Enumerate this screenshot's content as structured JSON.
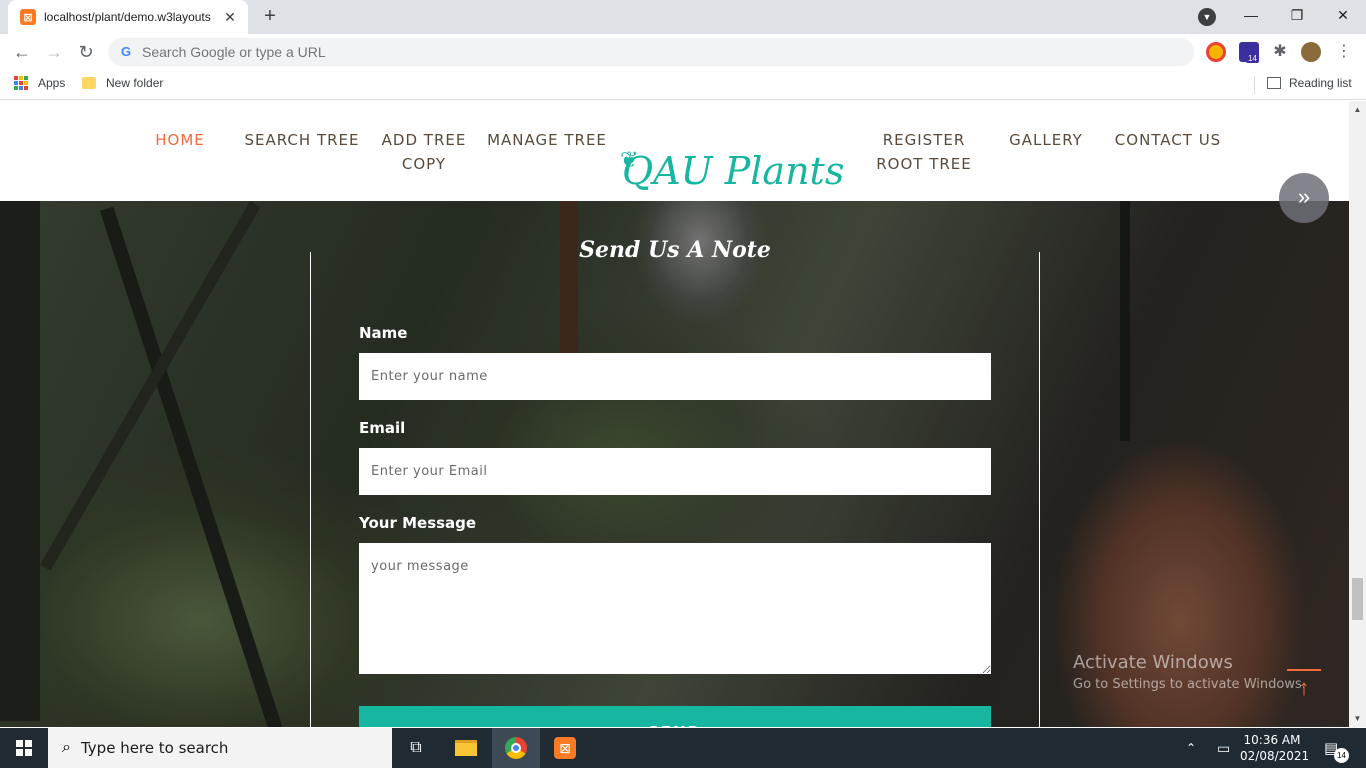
{
  "browser": {
    "tab_title": "localhost/plant/demo.w3layouts",
    "tab_close": "✕",
    "new_tab": "+",
    "omnibox_placeholder": "Search Google or type a URL",
    "profile_badge": "14",
    "bookmarks": {
      "apps": "Apps",
      "folder": "New folder",
      "reading_list": "Reading list"
    }
  },
  "site": {
    "nav": [
      {
        "label": "HOME",
        "active": true
      },
      {
        "label": "SEARCH TREE"
      },
      {
        "label": "ADD TREE\nCOPY"
      },
      {
        "label": "MANAGE TREE"
      },
      {
        "label": "REGISTER\nROOT TREE"
      },
      {
        "label": "GALLERY"
      },
      {
        "label": "CONTACT US"
      }
    ],
    "logo": "QAU Plants",
    "accent_color": "#16b6a0",
    "active_color": "#f26b3a"
  },
  "form": {
    "title": "Send Us A Note",
    "name_label": "Name",
    "name_placeholder": "Enter your name",
    "email_label": "Email",
    "email_placeholder": "Enter your Email",
    "message_label": "Your Message",
    "message_placeholder": "your message",
    "send_label": "SEND"
  },
  "watermark": {
    "title": "Activate Windows",
    "subtitle": "Go to Settings to activate Windows."
  },
  "taskbar": {
    "search_text": "Type here to search",
    "time": "10:36 AM",
    "date": "02/08/2021",
    "notification_count": "14"
  }
}
